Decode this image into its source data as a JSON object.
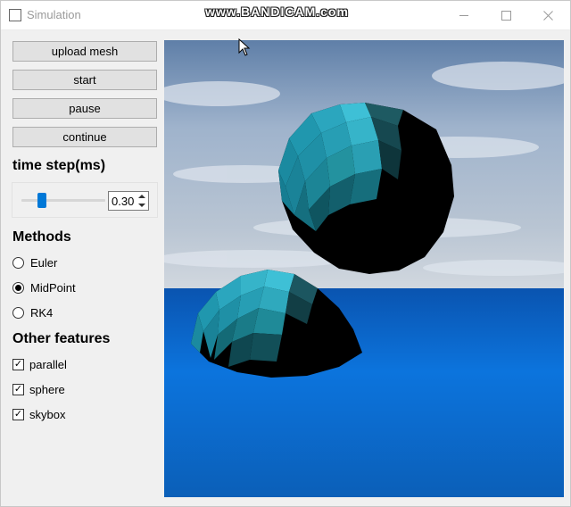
{
  "window": {
    "title": "Simulation",
    "watermark": "www.BANDICAM.com"
  },
  "panel": {
    "buttons": {
      "upload_mesh": "upload mesh",
      "start": "start",
      "pause": "pause",
      "continue": "continue"
    },
    "time_step": {
      "title": "time step(ms)",
      "value": "0.30",
      "slider_level": 0.3
    },
    "methods": {
      "title": "Methods",
      "options": [
        "Euler",
        "MidPoint",
        "RK4"
      ],
      "selected": "MidPoint"
    },
    "features": {
      "title": "Other features",
      "items": [
        {
          "label": "parallel",
          "checked": true
        },
        {
          "label": "sphere",
          "checked": true
        },
        {
          "label": "skybox",
          "checked": true
        }
      ]
    }
  },
  "colors": {
    "accent": "#0078d7",
    "sky": "#6f8fb8",
    "sea": "#0a6fd8",
    "sphere": "#2bb3c7"
  },
  "icons": [
    "app-icon",
    "minimize-icon",
    "maximize-icon",
    "close-icon",
    "spin-up-icon",
    "spin-down-icon",
    "cursor-icon"
  ]
}
